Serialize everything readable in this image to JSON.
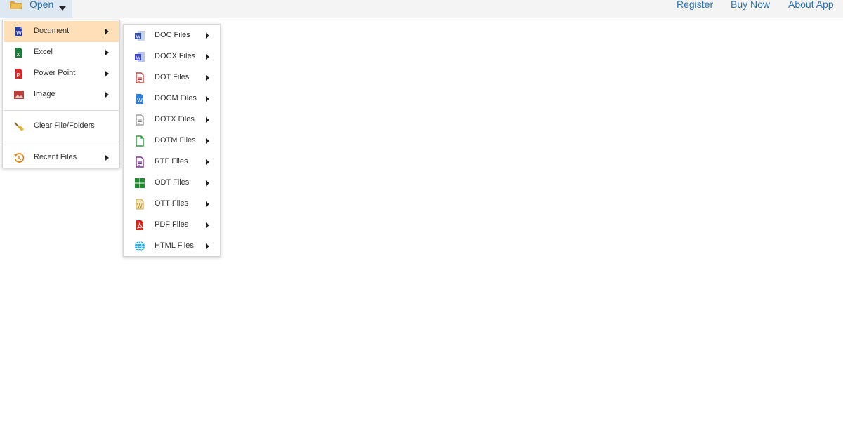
{
  "toolbar": {
    "open_label": "Open",
    "links": [
      "Register",
      "Buy Now",
      "About App"
    ]
  },
  "main_menu": {
    "items": [
      {
        "label": "Document",
        "icon": "word-doc-icon",
        "has_submenu": true,
        "active": true
      },
      {
        "label": "Excel",
        "icon": "excel-icon",
        "has_submenu": true
      },
      {
        "label": "Power Point",
        "icon": "powerpoint-icon",
        "has_submenu": true
      },
      {
        "label": "Image",
        "icon": "image-icon",
        "has_submenu": true
      },
      {
        "label": "Clear File/Folders",
        "icon": "broom-icon",
        "has_submenu": false
      },
      {
        "label": "Recent Files",
        "icon": "history-icon",
        "has_submenu": true
      }
    ]
  },
  "document_submenu": {
    "items": [
      {
        "label": "DOC Files",
        "icon": "doc-icon"
      },
      {
        "label": "DOCX Files",
        "icon": "docx-icon"
      },
      {
        "label": "DOT Files",
        "icon": "dot-icon"
      },
      {
        "label": "DOCM Files",
        "icon": "docm-icon"
      },
      {
        "label": "DOTX Files",
        "icon": "dotx-icon"
      },
      {
        "label": "DOTM Files",
        "icon": "dotm-icon"
      },
      {
        "label": "RTF Files",
        "icon": "rtf-icon"
      },
      {
        "label": "ODT Files",
        "icon": "odt-icon"
      },
      {
        "label": "OTT Files",
        "icon": "ott-icon"
      },
      {
        "label": "PDF Files",
        "icon": "pdf-icon"
      },
      {
        "label": "HTML Files",
        "icon": "html-globe-icon"
      }
    ]
  },
  "colors": {
    "accent": "#2b73b6",
    "active_item": "#ffdfb8",
    "topbar": "#f4f4f4"
  }
}
